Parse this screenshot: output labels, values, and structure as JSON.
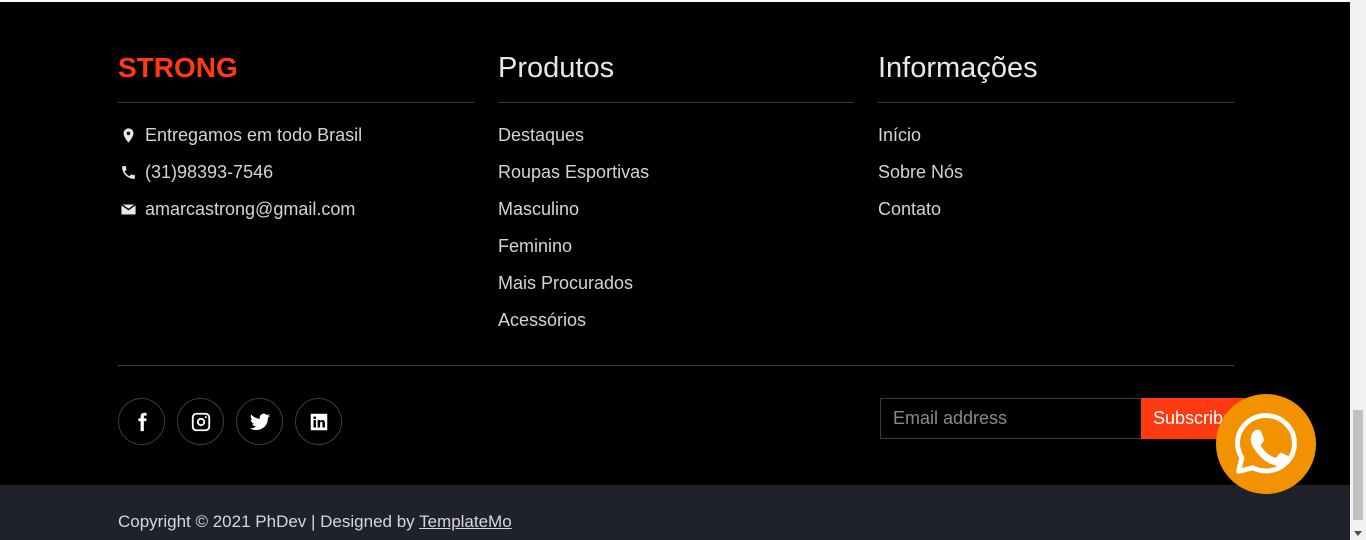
{
  "brand": {
    "name": "STRONG",
    "color": "#ff3a10"
  },
  "contact": {
    "items": [
      {
        "icon": "map-marker-icon",
        "text": "Entregamos em todo Brasil"
      },
      {
        "icon": "phone-icon",
        "text": "(31)98393-7546"
      },
      {
        "icon": "envelope-icon",
        "text": "amarcastrong@gmail.com"
      }
    ]
  },
  "produtos": {
    "title": "Produtos",
    "items": [
      "Destaques",
      "Roupas Esportivas",
      "Masculino",
      "Feminino",
      "Mais Procurados",
      "Acessórios"
    ]
  },
  "informacoes": {
    "title": "Informações",
    "items": [
      "Início",
      "Sobre Nós",
      "Contato"
    ]
  },
  "social": [
    "facebook-icon",
    "instagram-icon",
    "twitter-icon",
    "linkedin-icon"
  ],
  "subscribe": {
    "placeholder": "Email address",
    "button_label": "Subscribe"
  },
  "whatsapp": {
    "icon": "whatsapp-icon",
    "color": "#f29200"
  },
  "footer_bottom": {
    "copyright": "Copyright © 2021 PhDev | Designed by ",
    "link": "TemplateMo"
  }
}
